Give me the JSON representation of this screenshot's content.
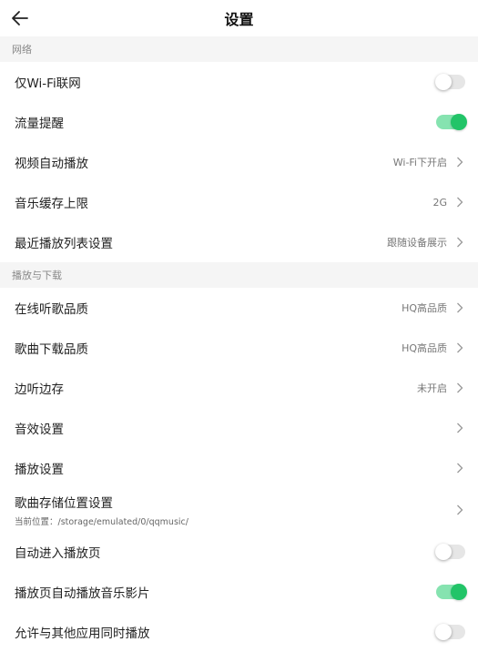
{
  "header": {
    "title": "设置"
  },
  "sections": {
    "network": "网络",
    "playback": "播放与下载"
  },
  "rows": {
    "wifi_only": {
      "label": "仅Wi-Fi联网",
      "toggle": "off"
    },
    "data_alert": {
      "label": "流量提醒",
      "toggle": "on"
    },
    "video_autoplay": {
      "label": "视频自动播放",
      "value": "Wi-Fi下开启"
    },
    "music_cache": {
      "label": "音乐缓存上限",
      "value": "2G"
    },
    "recent_list": {
      "label": "最近播放列表设置",
      "value": "跟随设备展示"
    },
    "online_quality": {
      "label": "在线听歌品质",
      "value": "HQ高品质"
    },
    "download_quality": {
      "label": "歌曲下载品质",
      "value": "HQ高品质"
    },
    "cache_while_listen": {
      "label": "边听边存",
      "value": "未开启"
    },
    "sound_effect": {
      "label": "音效设置"
    },
    "playback_settings": {
      "label": "播放设置"
    },
    "storage_location": {
      "label": "歌曲存储位置设置",
      "sub": "当前位置：/storage/emulated/0/qqmusic/"
    },
    "auto_enter_player": {
      "label": "自动进入播放页",
      "toggle": "off"
    },
    "auto_play_mv": {
      "label": "播放页自动播放音乐影片",
      "toggle": "on"
    },
    "allow_other_apps": {
      "label": "允许与其他应用同时播放",
      "toggle": "off"
    }
  },
  "icons": {
    "back": "arrow-left-icon",
    "chevron": "chevron-right-icon"
  },
  "colors": {
    "toggle_on": "#22c468",
    "toggle_on_track": "#86e3b0",
    "toggle_off_track": "#e6e6e6"
  }
}
